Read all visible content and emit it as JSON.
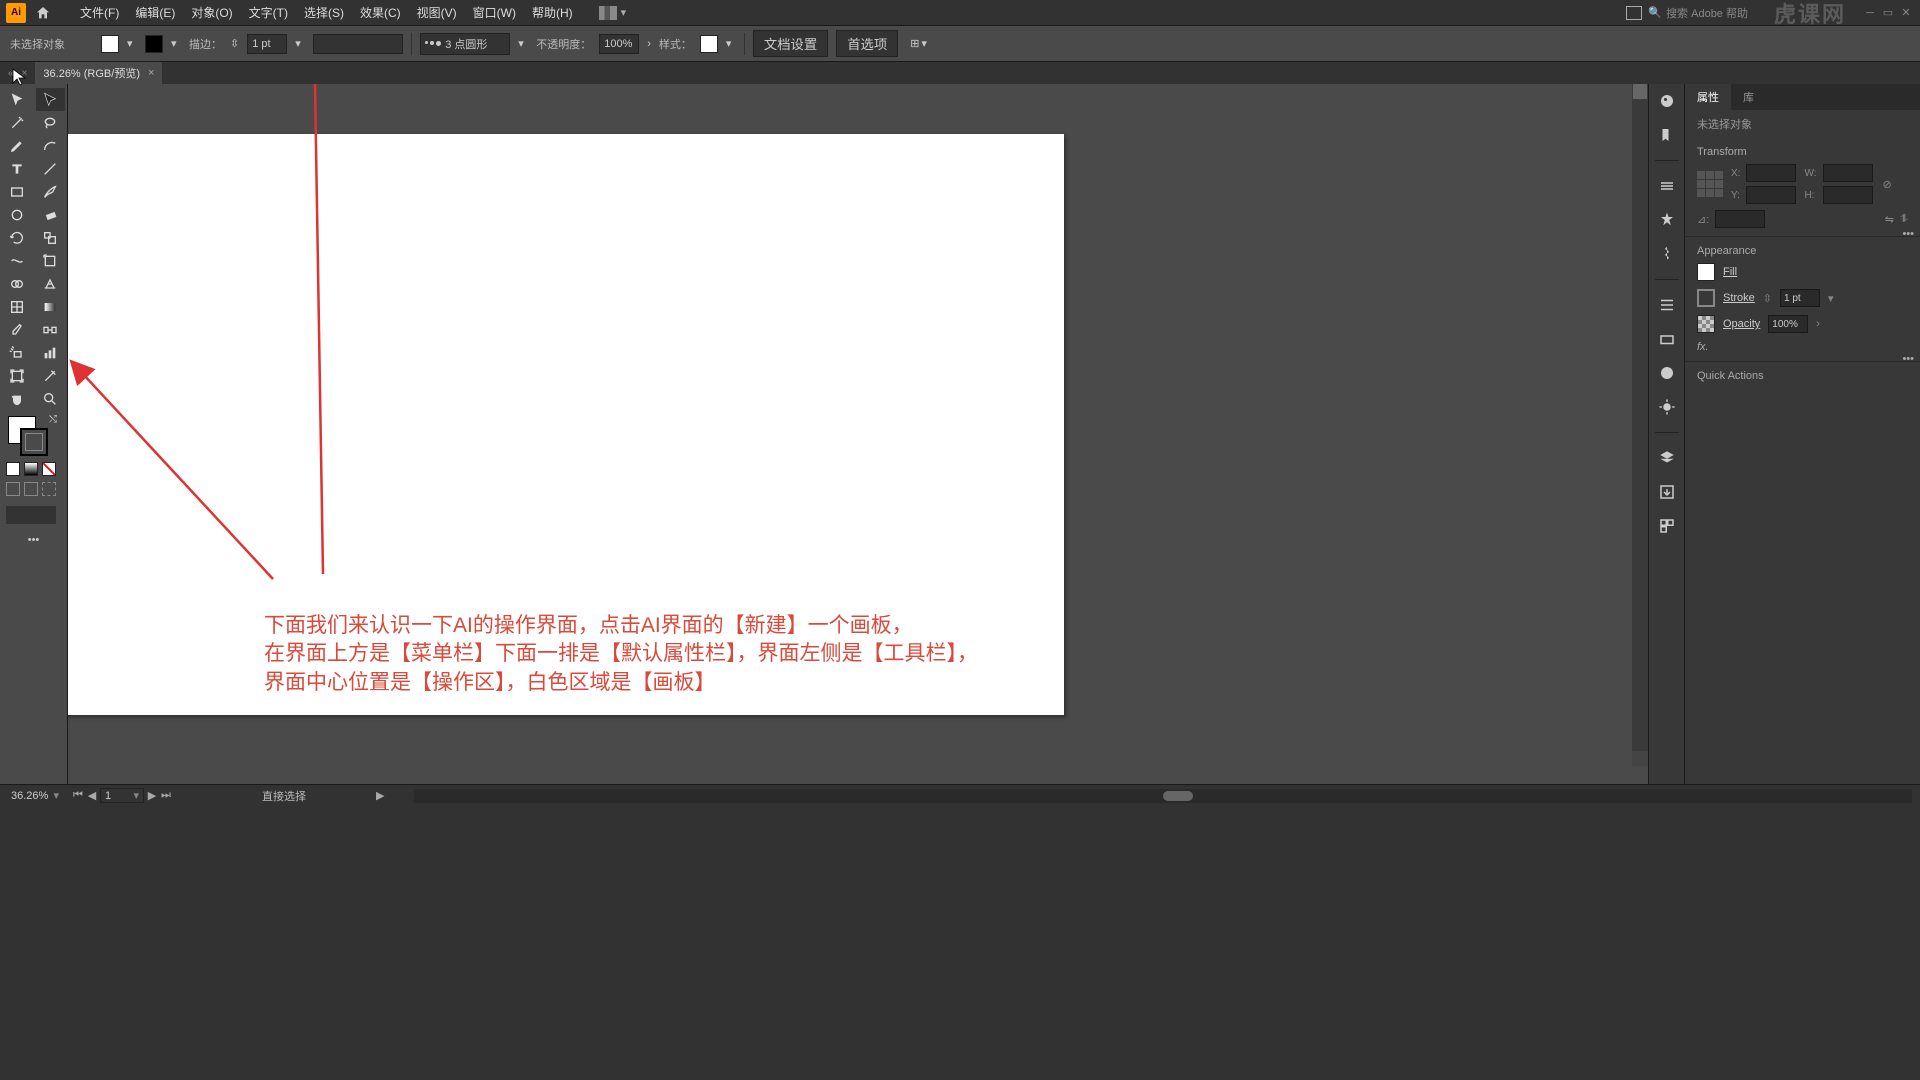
{
  "menubar": {
    "items": [
      "文件(F)",
      "编辑(E)",
      "对象(O)",
      "文字(T)",
      "选择(S)",
      "效果(C)",
      "视图(V)",
      "窗口(W)",
      "帮助(H)"
    ],
    "search_placeholder": "搜索 Adobe 帮助",
    "watermark": "虎课网"
  },
  "controlbar": {
    "noselection": "未选择对象",
    "stroke_label": "描边：",
    "stroke_value": "1 pt",
    "profile_label": "3 点圆形",
    "opacity_label": "不透明度：",
    "opacity_value": "100%",
    "style_label": "样式：",
    "doc_setup": "文档设置",
    "prefs": "首选项"
  },
  "doc_tab": {
    "title": "36.26% (RGB/预览)"
  },
  "annotation": {
    "line1": "下面我们来认识一下AI的操作界面，点击AI界面的【新建】一个画板，",
    "line2": "在界面上方是【菜单栏】下面一排是【默认属性栏】，界面左侧是【工具栏】，",
    "line3": "界面中心位置是【操作区】，白色区域是【画板】"
  },
  "properties": {
    "tab_props": "属性",
    "tab_lib": "库",
    "noselection": "未选择对象",
    "transform_title": "Transform",
    "x_label": "X:",
    "y_label": "Y:",
    "w_label": "W:",
    "h_label": "H:",
    "angle_label": "⊿:",
    "appearance_title": "Appearance",
    "fill_label": "Fill",
    "stroke_label": "Stroke",
    "stroke_value": "1 pt",
    "opacity_label": "Opacity",
    "opacity_value": "100%",
    "fx_label": "fx.",
    "quick_actions": "Quick Actions"
  },
  "statusbar": {
    "zoom": "36.26%",
    "artboard": "1",
    "tool": "直接选择"
  }
}
